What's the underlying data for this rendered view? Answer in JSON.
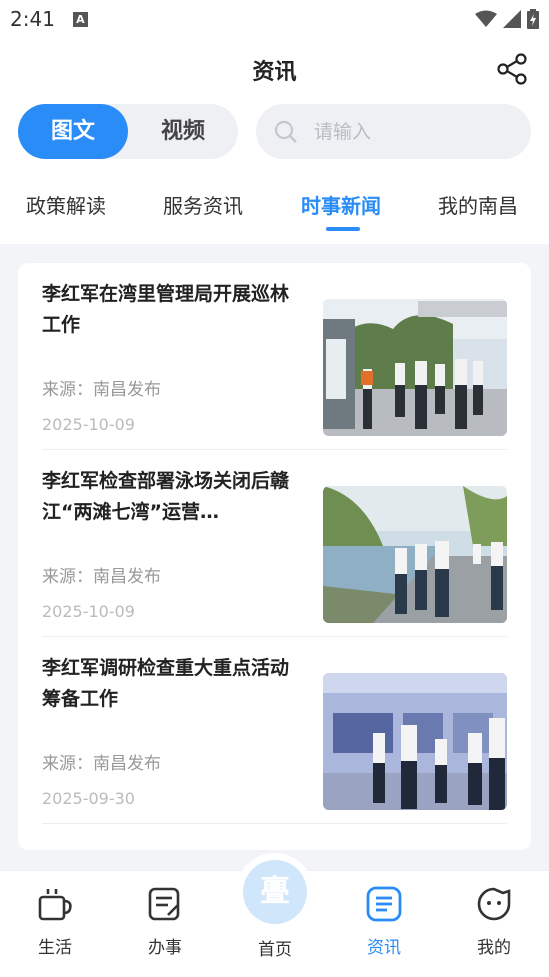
{
  "status": {
    "time": "2:41",
    "notif_letter": "A"
  },
  "header": {
    "title": "资讯"
  },
  "toggle": {
    "active": "图文",
    "inactive": "视频"
  },
  "search": {
    "placeholder": "请输入",
    "value": ""
  },
  "tabs": [
    {
      "label": "政策解读"
    },
    {
      "label": "服务资讯"
    },
    {
      "label": "时事新闻"
    },
    {
      "label": "我的南昌"
    }
  ],
  "news": [
    {
      "title": "李红军在湾里管理局开展巡林工作",
      "source": "来源：南昌发布",
      "date": "2025-10-09"
    },
    {
      "title": "李红军检查部署泳场关闭后赣江“两滩七湾”运营…",
      "source": "来源：南昌发布",
      "date": "2025-10-09"
    },
    {
      "title": "李红军调研检查重大重点活动筹备工作",
      "source": "来源：南昌发布",
      "date": "2025-09-30"
    }
  ],
  "nav": {
    "life": "生活",
    "affairs": "办事",
    "home": "首页",
    "news": "资讯",
    "mine": "我的",
    "home_glyph": "亹"
  },
  "colors": {
    "accent": "#2a8cf7",
    "background": "#f2f4f7"
  }
}
